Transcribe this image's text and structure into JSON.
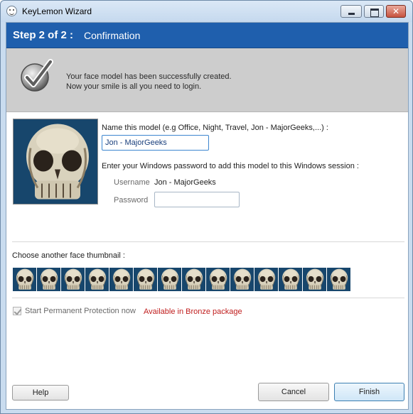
{
  "window": {
    "title": "KeyLemon Wizard"
  },
  "header": {
    "step": "Step 2 of 2 :",
    "title": "Confirmation"
  },
  "success": {
    "line1": "Your face model has been successfully created.",
    "line2": "Now your smile is all you need to login."
  },
  "model": {
    "name_label": "Name this model (e.g Office, Night, Travel, Jon - MajorGeeks,...) :",
    "name_value": "Jon - MajorGeeks",
    "password_intro": "Enter your Windows password to add this model to this Windows session :",
    "username_label": "Username",
    "username_value": "Jon - MajorGeeks",
    "password_label": "Password",
    "password_value": ""
  },
  "thumbnails": {
    "label": "Choose another face thumbnail :",
    "count": 14
  },
  "protection": {
    "label": "Start Permanent Protection now",
    "checked": true,
    "enabled": false,
    "note": "Available in Bronze package"
  },
  "buttons": {
    "help": "Help",
    "cancel": "Cancel",
    "finish": "Finish"
  },
  "colors": {
    "header": "#1f5fad",
    "note": "#c01d1d",
    "panel": "#cdcdcd"
  },
  "icons": {
    "app": "keylemon-smiley-icon",
    "success": "checkmark-icon"
  }
}
